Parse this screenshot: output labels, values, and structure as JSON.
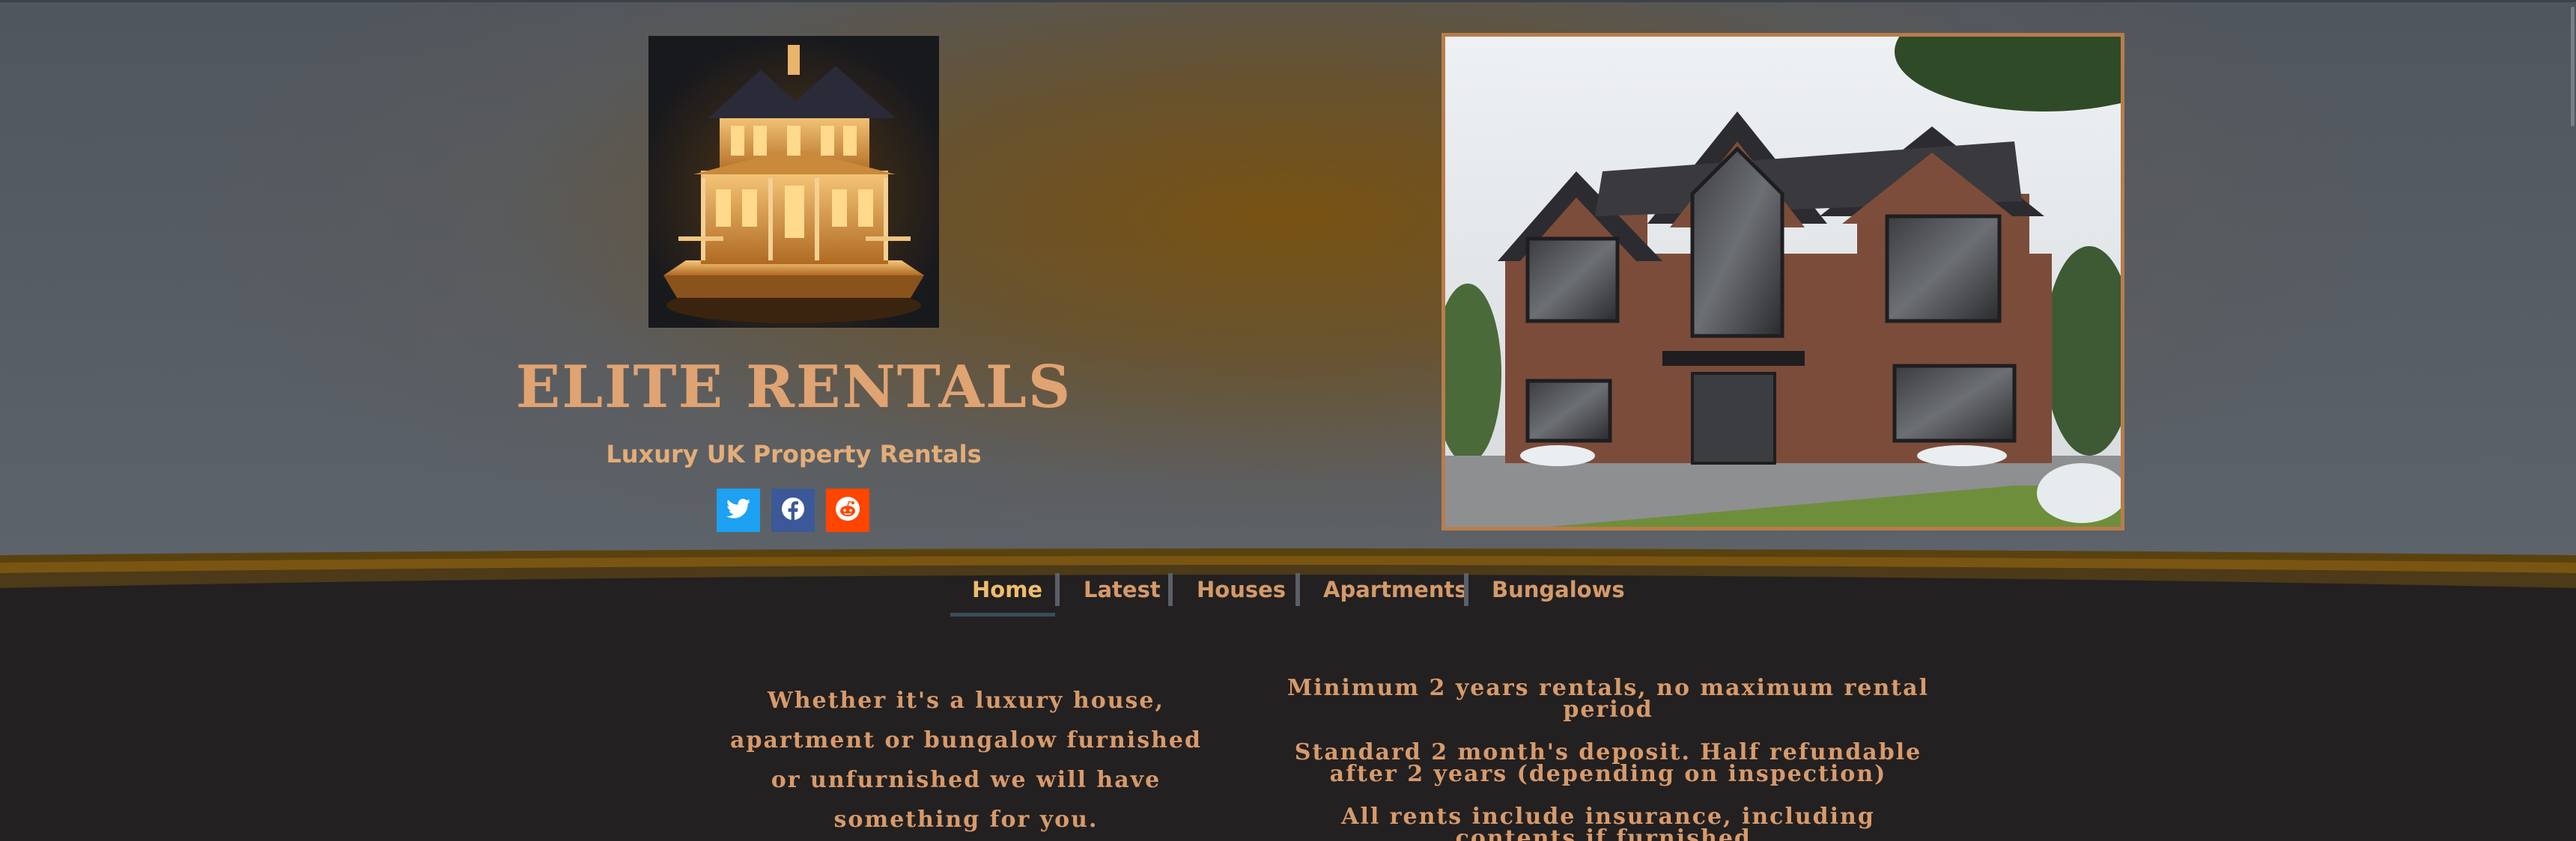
{
  "header": {
    "title": "ELITE RENTALS",
    "subtitle": "Luxury UK Property Rentals",
    "logo_icon": "golden-mansion-icon",
    "photo": "brick-house-photo"
  },
  "social": [
    {
      "name": "Twitter",
      "icon": "twitter-icon",
      "color": "#1da1f2"
    },
    {
      "name": "Facebook",
      "icon": "facebook-icon",
      "color": "#3b5998"
    },
    {
      "name": "Reddit",
      "icon": "reddit-icon",
      "color": "#ff4500"
    }
  ],
  "nav": {
    "items": [
      {
        "label": "Home",
        "active": true
      },
      {
        "label": "Latest"
      },
      {
        "label": "Houses"
      },
      {
        "label": "Apartments"
      },
      {
        "label": "Bungalows"
      }
    ]
  },
  "content": {
    "intro": "Whether it's a luxury house, apartment or bungalow furnished or unfurnished we will have something for you.",
    "terms": [
      "Minimum 2 years rentals, no maximum rental period",
      "Standard 2 month's deposit. Half refundable after 2 years (depending on inspection)",
      "All rents include insurance, including contents if furnished."
    ]
  },
  "colors": {
    "accent": "#e0a372",
    "nav_active": "#f0bd6c",
    "background": "#232021",
    "frame": "#b97d4a"
  }
}
